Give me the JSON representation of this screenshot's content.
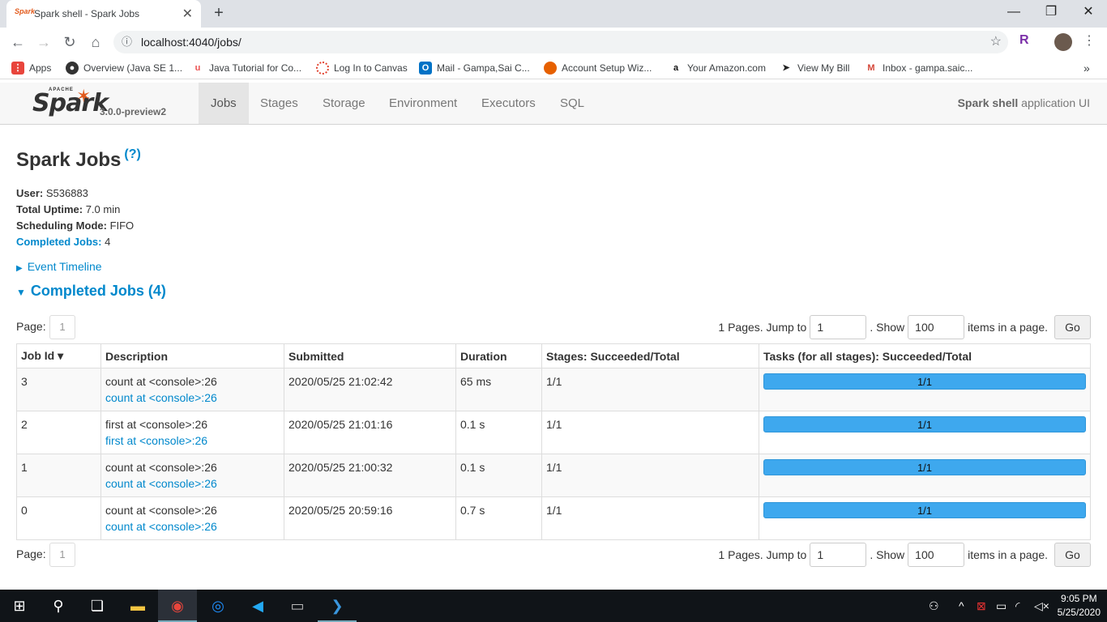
{
  "browser": {
    "tab_title": "Spark shell - Spark Jobs",
    "tab_favicon": "Spark",
    "url": "localhost:4040/jobs/",
    "bookmarks": [
      {
        "label": "Apps",
        "icon": "apps-grid-icon",
        "color": "#e8453c"
      },
      {
        "label": "Overview (Java SE 1...",
        "icon": "globe-icon",
        "color": "#333333"
      },
      {
        "label": "Java Tutorial for Co...",
        "icon": "udemy-icon",
        "color": "#ec5252"
      },
      {
        "label": "Log In to Canvas",
        "icon": "canvas-icon",
        "color": "#e13f2b"
      },
      {
        "label": "Mail - Gampa,Sai C...",
        "icon": "outlook-icon",
        "color": "#0072c6"
      },
      {
        "label": "Account Setup Wiz...",
        "icon": "firefox-icon",
        "color": "#e66000"
      },
      {
        "label": "Your Amazon.com",
        "icon": "amazon-icon",
        "color": "#111111"
      },
      {
        "label": "View My Bill",
        "icon": "sprint-icon",
        "color": "#222222"
      },
      {
        "label": "Inbox - gampa.saic...",
        "icon": "gmail-icon",
        "color": "#d44638"
      }
    ],
    "overflow": "»"
  },
  "spark": {
    "logo_apache": "APACHE",
    "logo_text": "Spark",
    "version": "3.0.0-preview2",
    "nav": [
      "Jobs",
      "Stages",
      "Storage",
      "Environment",
      "Executors",
      "SQL"
    ],
    "active_nav": "Jobs",
    "app_name": "Spark shell",
    "app_suffix": " application UI"
  },
  "page": {
    "title": "Spark Jobs",
    "help": "(?)",
    "summary": {
      "user_label": "User:",
      "user": " S536883",
      "uptime_label": "Total Uptime:",
      "uptime": " 7.0 min",
      "mode_label": "Scheduling Mode:",
      "mode": " FIFO",
      "completed_label": "Completed Jobs:",
      "completed": " 4"
    },
    "event_timeline": "Event Timeline",
    "completed_header": "Completed Jobs (4)"
  },
  "pager": {
    "page_label": "Page:",
    "page_value": "1",
    "pages_text": "1 Pages. Jump to",
    "jump_value": "1",
    "show_text": ". Show",
    "show_value": "100",
    "items_text": "items in a page.",
    "go": "Go"
  },
  "table": {
    "headers": [
      "Job Id ▾",
      "Description",
      "Submitted",
      "Duration",
      "Stages: Succeeded/Total",
      "Tasks (for all stages): Succeeded/Total"
    ],
    "rows": [
      {
        "id": "3",
        "desc": "count at <console>:26",
        "link": "count at <console>:26",
        "submitted": "2020/05/25 21:02:42",
        "duration": "65 ms",
        "stages": "1/1",
        "tasks": "1/1",
        "task_fraction": 1.0
      },
      {
        "id": "2",
        "desc": "first at <console>:26",
        "link": "first at <console>:26",
        "submitted": "2020/05/25 21:01:16",
        "duration": "0.1 s",
        "stages": "1/1",
        "tasks": "1/1",
        "task_fraction": 1.0
      },
      {
        "id": "1",
        "desc": "count at <console>:26",
        "link": "count at <console>:26",
        "submitted": "2020/05/25 21:00:32",
        "duration": "0.1 s",
        "stages": "1/1",
        "tasks": "1/1",
        "task_fraction": 1.0
      },
      {
        "id": "0",
        "desc": "count at <console>:26",
        "link": "count at <console>:26",
        "submitted": "2020/05/25 20:59:16",
        "duration": "0.7 s",
        "stages": "1/1",
        "tasks": "1/1",
        "task_fraction": 1.0
      }
    ]
  },
  "taskbar": {
    "time": "9:05 PM",
    "date": "5/25/2020"
  }
}
